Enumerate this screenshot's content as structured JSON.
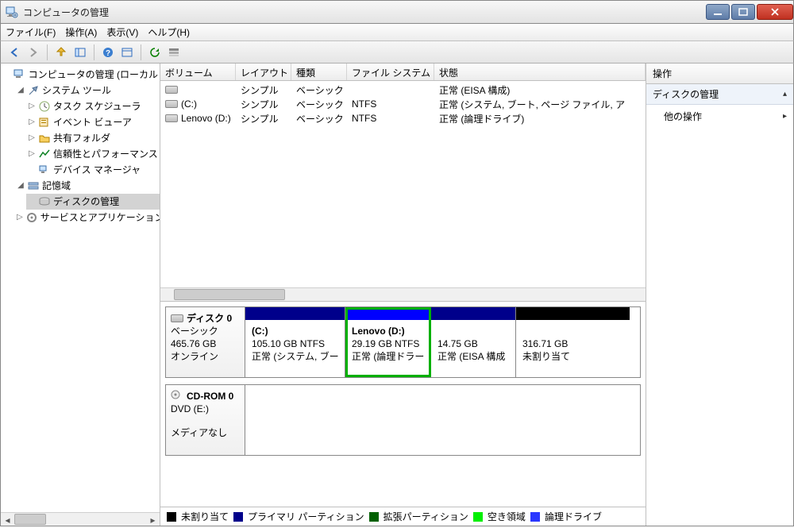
{
  "window": {
    "title": "コンピュータの管理"
  },
  "menu": {
    "file": "ファイル(F)",
    "action": "操作(A)",
    "view": "表示(V)",
    "help": "ヘルプ(H)"
  },
  "tree": {
    "root": "コンピュータの管理 (ローカル",
    "system_tools": "システム ツール",
    "task_scheduler": "タスク スケジューラ",
    "event_viewer": "イベント ビューア",
    "shared_folders": "共有フォルダ",
    "reliability_perf": "信頼性とパフォーマンス",
    "device_manager": "デバイス マネージャ",
    "storage": "記憶域",
    "disk_mgmt": "ディスクの管理",
    "services_apps": "サービスとアプリケーション"
  },
  "columns": {
    "volume": "ボリューム",
    "layout": "レイアウト",
    "kind": "種類",
    "fs": "ファイル システム",
    "status": "状態"
  },
  "volumes": [
    {
      "name": "",
      "layout": "シンプル",
      "kind": "ベーシック",
      "fs": "",
      "status": "正常 (EISA 構成)"
    },
    {
      "name": "(C:)",
      "layout": "シンプル",
      "kind": "ベーシック",
      "fs": "NTFS",
      "status": "正常 (システム, ブート, ページ ファイル, ア"
    },
    {
      "name": "Lenovo (D:)",
      "layout": "シンプル",
      "kind": "ベーシック",
      "fs": "NTFS",
      "status": "正常 (論理ドライブ)"
    }
  ],
  "disk0": {
    "title": "ディスク 0",
    "type": "ベーシック",
    "size": "465.76 GB",
    "state": "オンライン",
    "parts": [
      {
        "name": "(C:)",
        "size": "105.10 GB NTFS",
        "status": "正常 (システム, ブー",
        "band": "primary",
        "width": 126
      },
      {
        "name": "Lenovo (D:)",
        "size": "29.19 GB NTFS",
        "status": "正常 (論理ドラー",
        "band": "logical",
        "width": 108,
        "selected": true
      },
      {
        "name": "",
        "size": "14.75 GB",
        "status": "正常 (EISA 構成",
        "band": "primary",
        "width": 107
      },
      {
        "name": "",
        "size": "316.71 GB",
        "status": "未割り当て",
        "band": "unalloc",
        "width": 143
      }
    ]
  },
  "cdrom": {
    "title": "CD-ROM 0",
    "type": "DVD (E:)",
    "state": "メディアなし"
  },
  "legend": {
    "unallocated": "未割り当て",
    "primary": "プライマリ パーティション",
    "extended": "拡張パーティション",
    "free": "空き領域",
    "logical": "論理ドライブ"
  },
  "actions": {
    "header": "操作",
    "section": "ディスクの管理",
    "more": "他の操作"
  }
}
